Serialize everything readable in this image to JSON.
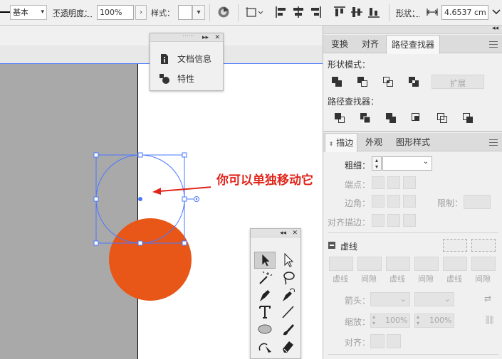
{
  "control_bar": {
    "stroke_style": "基本",
    "opacity_label": "不透明度：",
    "opacity_value": "100%",
    "style_label": "样式：",
    "shape_label": "形状：",
    "width_value": "4.6537 cm"
  },
  "doc_panel": {
    "items": [
      {
        "label": "文档信息",
        "icon": "info-doc-icon"
      },
      {
        "label": "特性",
        "icon": "attributes-icon"
      }
    ]
  },
  "right_panel": {
    "top_tabs": [
      "变换",
      "对齐",
      "路径查找器"
    ],
    "active_top_tab": "路径查找器",
    "shape_modes_label": "形状模式：",
    "expand_button": "扩展",
    "pathfinders_label": "路径查找器：",
    "bottom_tabs": [
      "描边",
      "外观",
      "图形样式"
    ],
    "active_bottom_tab": "描边",
    "weight_label": "粗细：",
    "cap_label": "端点：",
    "corner_label": "边角：",
    "limit_label": "限制：",
    "align_stroke_label": "对齐描边：",
    "dashed_label": "虚线",
    "dash_labels": [
      "虚线",
      "间隙",
      "虚线",
      "间隙",
      "虚线",
      "间隙"
    ],
    "arrowheads_label": "箭头：",
    "scale_label": "缩放：",
    "scale_values": [
      "100%",
      "100%"
    ],
    "align_label": "对齐："
  },
  "annotation": {
    "text": "你可以单独移动它",
    "color": "#e0251b"
  },
  "colors": {
    "selection": "#4a78ff",
    "orange_circle": "#e85618",
    "artboard_dark": "#a9a9a9"
  }
}
